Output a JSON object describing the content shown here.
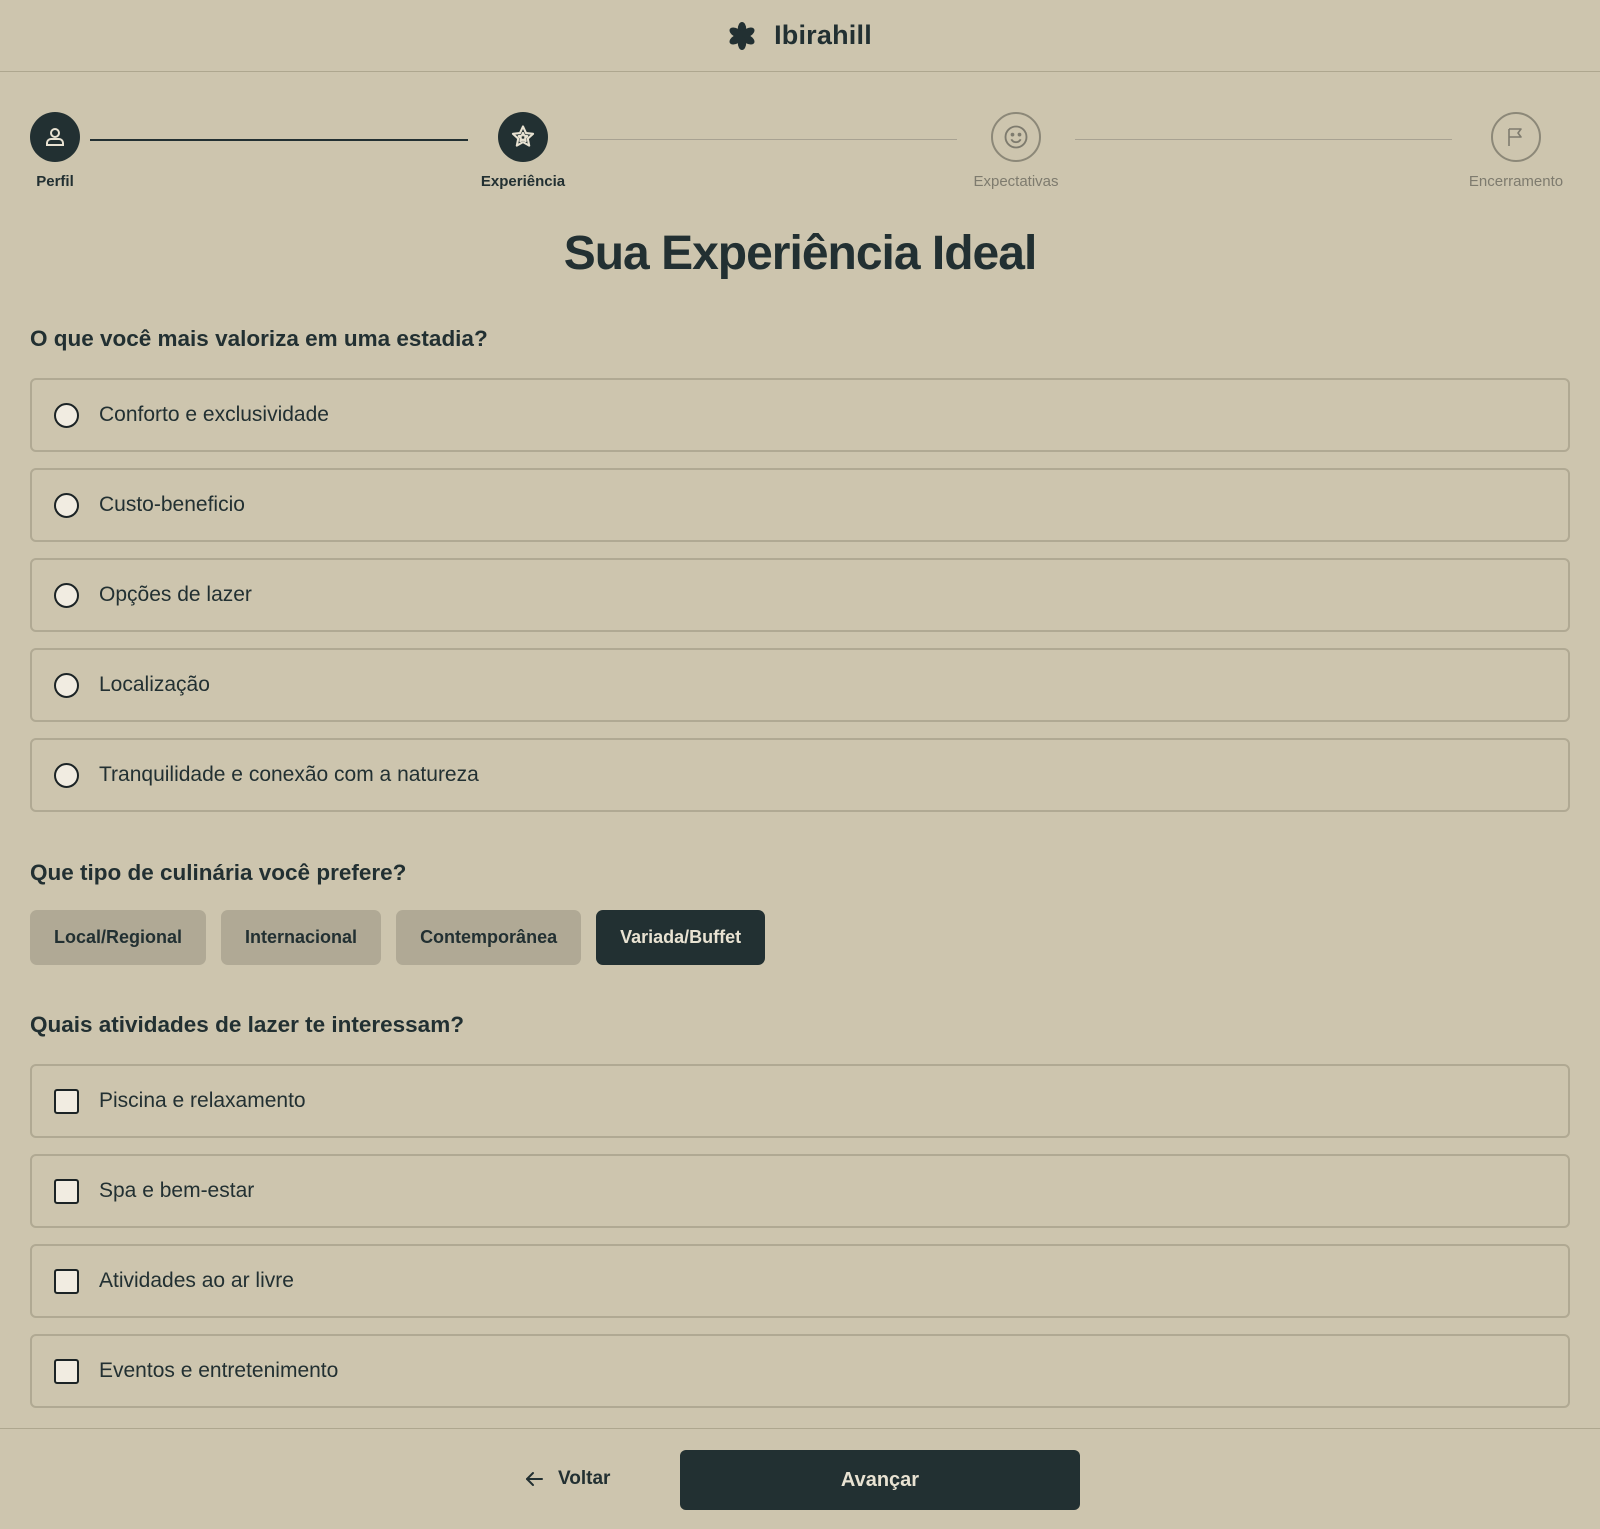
{
  "header": {
    "brand": "Ibirahill",
    "logo_icon": "asterisk-flower-icon"
  },
  "stepper": {
    "steps": [
      {
        "label": "Perfil",
        "icon": "person-icon",
        "state": "active"
      },
      {
        "label": "Experiência",
        "icon": "star-icon",
        "state": "active"
      },
      {
        "label": "Expectativas",
        "icon": "smile-icon",
        "state": "inactive"
      },
      {
        "label": "Encerramento",
        "icon": "flag-icon",
        "state": "inactive"
      }
    ]
  },
  "page_title": "Sua Experiência Ideal",
  "q1": {
    "title": "O que você mais valoriza em uma estadia?",
    "options": [
      "Conforto e exclusividade",
      "Custo-beneficio",
      "Opções de lazer",
      "Localização",
      "Tranquilidade e conexão com a natureza"
    ]
  },
  "q2": {
    "title": "Que tipo de culinária você prefere?",
    "options": [
      "Local/Regional",
      "Internacional",
      "Contemporânea",
      "Variada/Buffet"
    ],
    "selected": "Variada/Buffet"
  },
  "q3": {
    "title": "Quais atividades de lazer te interessam?",
    "options": [
      "Piscina e relaxamento",
      "Spa e bem-estar",
      "Atividades ao ar livre",
      "Eventos e entretenimento"
    ]
  },
  "footer": {
    "back_label": "Voltar",
    "next_label": "Avançar"
  },
  "colors": {
    "background": "#cdc5ae",
    "primary": "#223032",
    "chip": "#b0a995",
    "border": "#b0a993"
  }
}
